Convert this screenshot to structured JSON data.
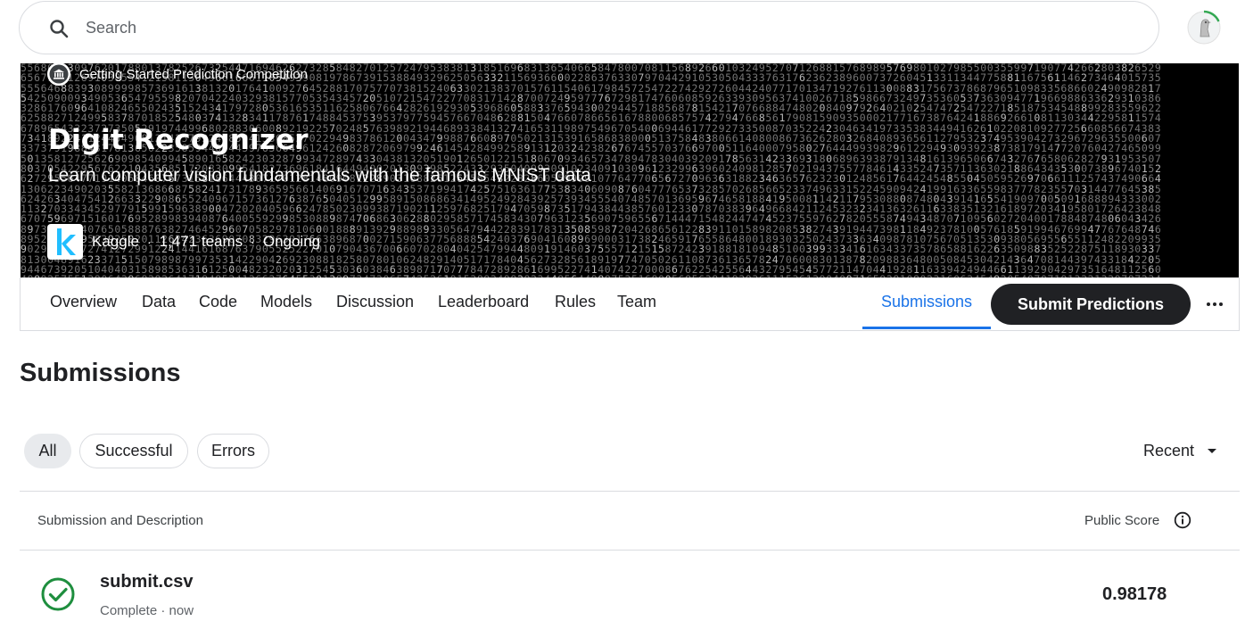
{
  "search": {
    "placeholder": "Search"
  },
  "competition": {
    "kind": "Getting Started Prediction Competition",
    "title": "Digit Recognizer",
    "subtitle": "Learn computer vision fundamentals with the famous MNIST data",
    "host": "Kaggle",
    "teams": "1,471 teams",
    "status": "Ongoing",
    "separator": "·"
  },
  "tabs": [
    {
      "label": "Overview"
    },
    {
      "label": "Data"
    },
    {
      "label": "Code"
    },
    {
      "label": "Models"
    },
    {
      "label": "Discussion"
    },
    {
      "label": "Leaderboard"
    },
    {
      "label": "Rules"
    },
    {
      "label": "Team"
    },
    {
      "label": "Submissions"
    }
  ],
  "active_tab": "Submissions",
  "actions": {
    "submit_label": "Submit Predictions"
  },
  "page": {
    "title": "Submissions"
  },
  "filters": [
    {
      "label": "All"
    },
    {
      "label": "Successful"
    },
    {
      "label": "Errors"
    }
  ],
  "selected_filter": "All",
  "sort": {
    "label": "Recent"
  },
  "table": {
    "headers": {
      "description": "Submission and Description",
      "score": "Public Score"
    },
    "rows": [
      {
        "name": "submit.csv",
        "meta": "Complete · now",
        "score": "0.98178",
        "status": "success"
      }
    ]
  },
  "colors": {
    "accent": "#1a73e8",
    "success": "#1e8e3e",
    "button_dark": "#202124",
    "kaggle_blue": "#20beff"
  }
}
